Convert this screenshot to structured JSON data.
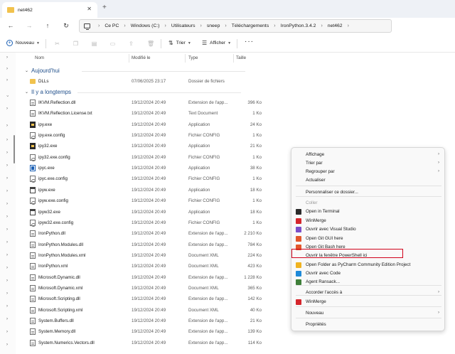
{
  "window": {
    "tab_title": "net462",
    "tab_close": "✕",
    "new_tab": "+"
  },
  "nav": {
    "back": "←",
    "forward": "→",
    "up": "↑",
    "refresh": "↻",
    "crumbs": [
      "Ce PC",
      "Windows (C:)",
      "Utilisateurs",
      "sneep",
      "Téléchargements",
      "IronPython.3.4.2",
      "net462"
    ],
    "sep": "›",
    "expand": "›"
  },
  "toolbar": {
    "new_label": "Nouveau",
    "sort_label": "Trier",
    "view_label": "Afficher",
    "more": "···"
  },
  "columns": {
    "name": "Nom",
    "modified": "Modifié le",
    "type": "Type",
    "size": "Taille"
  },
  "groups": {
    "today": "Aujourd'hui",
    "long_ago": "Il y a longtemps"
  },
  "files_today": [
    {
      "name": "DLLs",
      "date": "07/06/2025 23:17",
      "type": "Dossier de fichiers",
      "size": "",
      "icon": "folder-icon"
    }
  ],
  "files": [
    {
      "name": "IKVM.Reflection.dll",
      "date": "19/12/2024 20:49",
      "type": "Extension de l'app...",
      "size": "396 Ko",
      "icon": "file-icon"
    },
    {
      "name": "IKVM.Reflection.License.txt",
      "date": "19/12/2024 20:49",
      "type": "Text Document",
      "size": "1 Ko",
      "icon": "file-icon"
    },
    {
      "name": "ipy.exe",
      "date": "19/12/2024 20:49",
      "type": "Application",
      "size": "24 Ko",
      "icon": "exe-icon"
    },
    {
      "name": "ipy.exe.config",
      "date": "19/12/2024 20:49",
      "type": "Fichier CONFIG",
      "size": "1 Ko",
      "icon": "config-icon"
    },
    {
      "name": "ipy32.exe",
      "date": "19/12/2024 20:49",
      "type": "Application",
      "size": "21 Ko",
      "icon": "exe-icon"
    },
    {
      "name": "ipy32.exe.config",
      "date": "19/12/2024 20:49",
      "type": "Fichier CONFIG",
      "size": "1 Ko",
      "icon": "config-icon"
    },
    {
      "name": "ipyc.exe",
      "date": "19/12/2024 20:49",
      "type": "Application",
      "size": "38 Ko",
      "icon": "app-icon"
    },
    {
      "name": "ipyc.exe.config",
      "date": "19/12/2024 20:49",
      "type": "Fichier CONFIG",
      "size": "1 Ko",
      "icon": "config-icon"
    },
    {
      "name": "ipyw.exe",
      "date": "19/12/2024 20:49",
      "type": "Application",
      "size": "18 Ko",
      "icon": "window-icon"
    },
    {
      "name": "ipyw.exe.config",
      "date": "19/12/2024 20:49",
      "type": "Fichier CONFIG",
      "size": "1 Ko",
      "icon": "config-icon"
    },
    {
      "name": "ipyw32.exe",
      "date": "19/12/2024 20:49",
      "type": "Application",
      "size": "18 Ko",
      "icon": "window-icon"
    },
    {
      "name": "ipyw32.exe.config",
      "date": "19/12/2024 20:49",
      "type": "Fichier CONFIG",
      "size": "1 Ko",
      "icon": "config-icon"
    },
    {
      "name": "IronPython.dll",
      "date": "19/12/2024 20:49",
      "type": "Extension de l'app...",
      "size": "2 210 Ko",
      "icon": "file-icon"
    },
    {
      "name": "IronPython.Modules.dll",
      "date": "19/12/2024 20:49",
      "type": "Extension de l'app...",
      "size": "784 Ko",
      "icon": "file-icon"
    },
    {
      "name": "IronPython.Modules.xml",
      "date": "19/12/2024 20:49",
      "type": "Document XML",
      "size": "224 Ko",
      "icon": "file-icon"
    },
    {
      "name": "IronPython.xml",
      "date": "19/12/2024 20:49",
      "type": "Document XML",
      "size": "423 Ko",
      "icon": "file-icon"
    },
    {
      "name": "Microsoft.Dynamic.dll",
      "date": "19/12/2024 20:49",
      "type": "Extension de l'app...",
      "size": "1 228 Ko",
      "icon": "file-icon"
    },
    {
      "name": "Microsoft.Dynamic.xml",
      "date": "19/12/2024 20:49",
      "type": "Document XML",
      "size": "365 Ko",
      "icon": "file-icon"
    },
    {
      "name": "Microsoft.Scripting.dll",
      "date": "19/12/2024 20:49",
      "type": "Extension de l'app...",
      "size": "142 Ko",
      "icon": "file-icon"
    },
    {
      "name": "Microsoft.Scripting.xml",
      "date": "19/12/2024 20:49",
      "type": "Document XML",
      "size": "40 Ko",
      "icon": "file-icon"
    },
    {
      "name": "System.Buffers.dll",
      "date": "19/12/2024 20:49",
      "type": "Extension de l'app...",
      "size": "21 Ko",
      "icon": "file-icon"
    },
    {
      "name": "System.Memory.dll",
      "date": "19/12/2024 20:49",
      "type": "Extension de l'app...",
      "size": "139 Ko",
      "icon": "file-icon"
    },
    {
      "name": "System.Numerics.Vectors.dll",
      "date": "19/12/2024 20:49",
      "type": "Extension de l'app...",
      "size": "114 Ko",
      "icon": "file-icon"
    }
  ],
  "context_menu": {
    "items": [
      {
        "label": "Affichage",
        "arrow": "›",
        "disabled": false,
        "icon": ""
      },
      {
        "label": "Trier par",
        "arrow": "›",
        "disabled": false,
        "icon": ""
      },
      {
        "label": "Regrouper par",
        "arrow": "›",
        "disabled": false,
        "icon": ""
      },
      {
        "label": "Actualiser",
        "arrow": "",
        "disabled": false,
        "icon": ""
      },
      {
        "label": "Personnaliser ce dossier...",
        "arrow": "",
        "disabled": false,
        "icon": ""
      },
      {
        "label": "Coller",
        "arrow": "",
        "disabled": true,
        "icon": ""
      },
      {
        "label": "Open in Terminal",
        "arrow": "",
        "disabled": false,
        "icon": "terminal-icon"
      },
      {
        "label": "WinMerge",
        "arrow": "",
        "disabled": false,
        "icon": "winmerge-icon"
      },
      {
        "label": "Ouvrir avec Visual Studio",
        "arrow": "",
        "disabled": false,
        "icon": "visual-studio-icon"
      },
      {
        "label": "Open Git GUI here",
        "arrow": "",
        "disabled": false,
        "icon": "git-gui-icon"
      },
      {
        "label": "Open Git Bash here",
        "arrow": "",
        "disabled": false,
        "icon": "git-bash-icon"
      },
      {
        "label": "Ouvrir la fenêtre PowerShell ici",
        "arrow": "",
        "disabled": false,
        "icon": ""
      },
      {
        "label": "Open Folder as PyCharm Community Edition Project",
        "arrow": "",
        "disabled": false,
        "icon": "pycharm-icon"
      },
      {
        "label": "Ouvrir avec Code",
        "arrow": "",
        "disabled": false,
        "icon": "vscode-icon"
      },
      {
        "label": "Agent Ransack...",
        "arrow": "",
        "disabled": false,
        "icon": "search-icon"
      },
      {
        "label": "Accorder l'accès à",
        "arrow": "›",
        "disabled": false,
        "icon": ""
      },
      {
        "label": "WinMerge",
        "arrow": "",
        "disabled": false,
        "icon": "winmerge-icon"
      },
      {
        "label": "Nouveau",
        "arrow": "›",
        "disabled": false,
        "icon": ""
      },
      {
        "label": "Propriétés",
        "arrow": "",
        "disabled": false,
        "icon": ""
      }
    ]
  },
  "colors": {
    "accent": "#1a5fb4",
    "highlight_border": "#d0021b",
    "folder": "#f1c24d"
  }
}
